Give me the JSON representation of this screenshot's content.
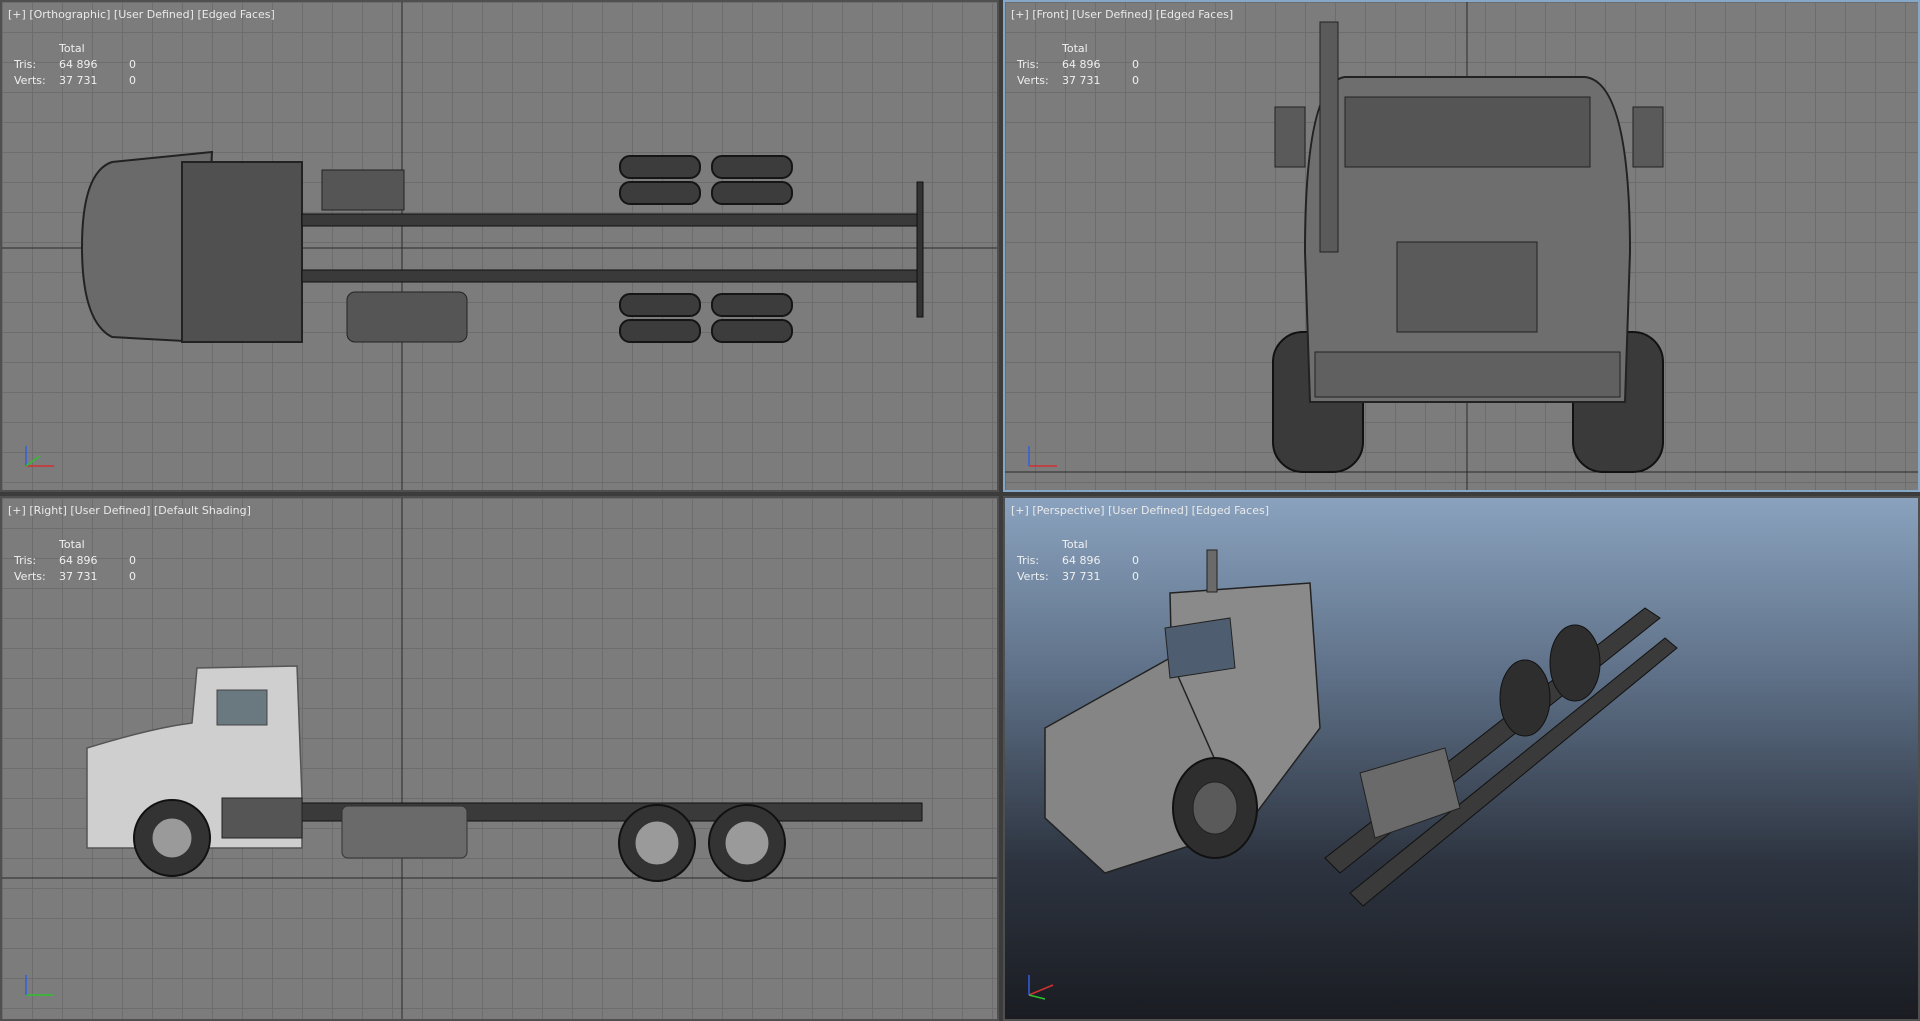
{
  "viewports": {
    "top": {
      "label": [
        "[+]",
        "[Orthographic]",
        "[User Defined]",
        "[Edged Faces]"
      ]
    },
    "front": {
      "label": [
        "[+]",
        "[Front]",
        "[User Defined]",
        "[Edged Faces]"
      ]
    },
    "right": {
      "label": [
        "[+]",
        "[Right]",
        "[User Defined]",
        "[Default Shading]"
      ]
    },
    "perspective": {
      "label": [
        "[+]",
        "[Perspective]",
        "[User Defined]",
        "[Edged Faces]"
      ]
    }
  },
  "stats": {
    "header": "Total",
    "tris_label": "Tris:",
    "tris_value": "64 896",
    "tris_sel": "0",
    "verts_label": "Verts:",
    "verts_value": "37 731",
    "verts_sel": "0"
  },
  "gizmo": {
    "x": "x",
    "y": "y",
    "z": "z"
  },
  "colors": {
    "active_border": "#86a8c8",
    "grid": "#7c7c7c",
    "axis_x": "#d03030",
    "axis_y": "#30c030",
    "axis_z": "#3060e0"
  }
}
